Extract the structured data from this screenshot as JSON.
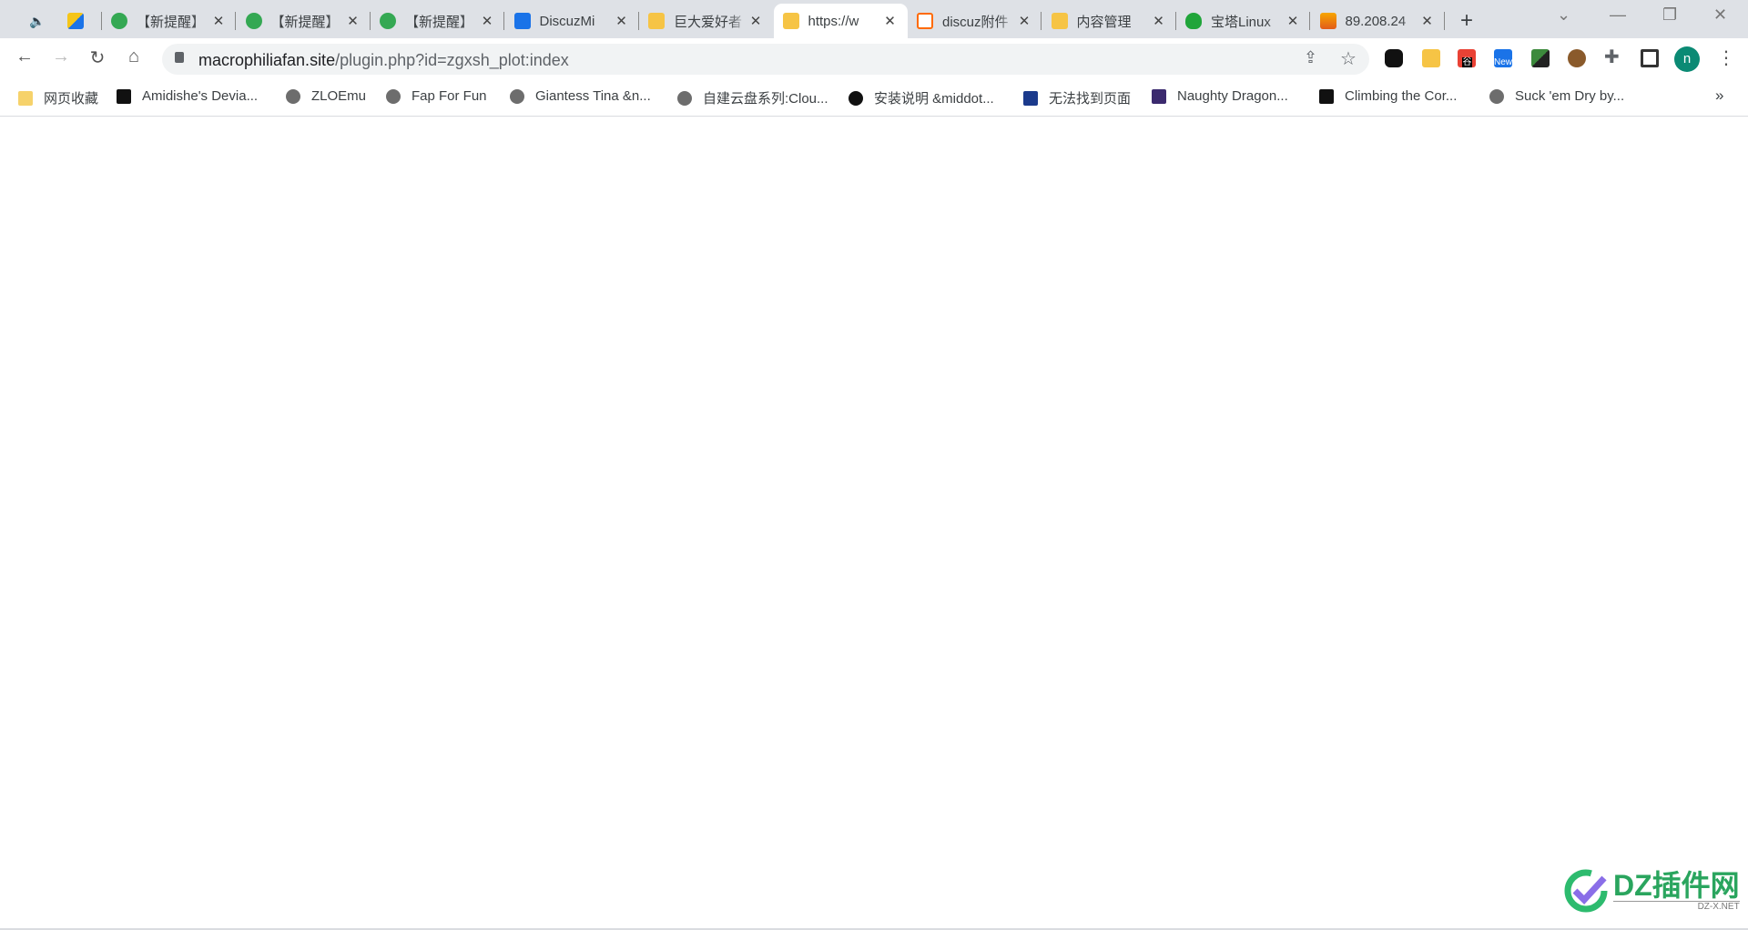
{
  "tabs": [
    {
      "title": "【新提醒】",
      "icon": "check-circle-icon"
    },
    {
      "title": "【新提醒】",
      "icon": "check-circle-icon"
    },
    {
      "title": "【新提醒】",
      "icon": "check-circle-icon"
    },
    {
      "title": "DiscuzMi",
      "icon": "discuz-mail-icon"
    },
    {
      "title": "巨大爱好者",
      "icon": "note-icon"
    },
    {
      "title": "https://w",
      "icon": "note-icon",
      "active": true
    },
    {
      "title": "discuz附件",
      "icon": "aliyun-icon"
    },
    {
      "title": "内容管理",
      "icon": "note-icon"
    },
    {
      "title": "宝塔Linux",
      "icon": "shield-icon"
    },
    {
      "title": "89.208.24",
      "icon": "phpmyadmin-icon"
    }
  ],
  "address": {
    "host": "macrophiliafan.site",
    "path": "/plugin.php?id=zgxsh_plot:index"
  },
  "profile_initial": "n",
  "extensions": {
    "translate_label": "谷歌",
    "new_badge": "New"
  },
  "bookmarks": [
    "网页收藏",
    "Amidishe's Devia...",
    "ZLOEmu",
    "Fap For Fun",
    "Giantess Tina &n...",
    "自建云盘系列:Clou...",
    "安装说明 &middot...",
    "无法找到页面",
    "Naughty Dragon...",
    "Climbing the Cor...",
    "Suck 'em Dry by..."
  ],
  "bookmarks_more": "»",
  "watermark": {
    "brand": "DZ插件网",
    "sub": "DZ-X.NET"
  },
  "colors": {
    "accent": "#1a73e8",
    "tabbar": "#dee1e6",
    "profile": "#0b8a74"
  }
}
